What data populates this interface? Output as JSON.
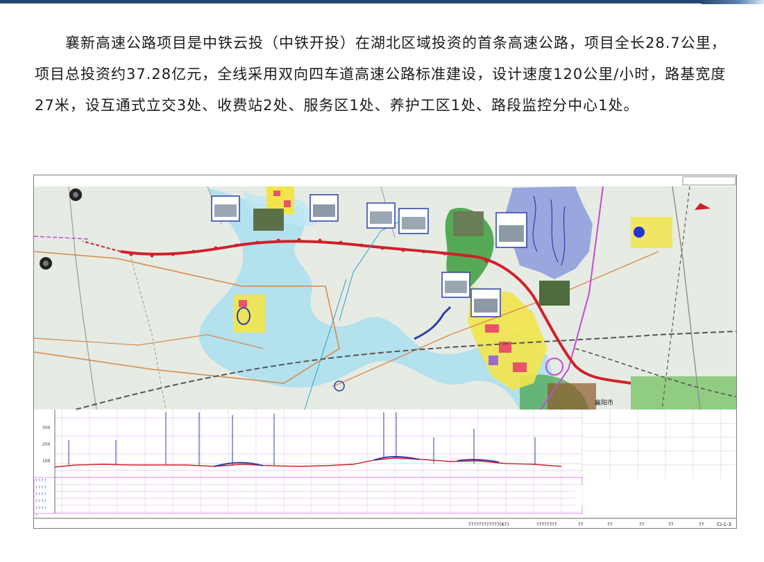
{
  "article": {
    "paragraph": "　　襄新高速公路项目是中铁云投（中铁开投）在湖北区域投资的首条高速公路，项目全长28.7公里，项目总投资约37.28亿元，全线采用双向四车道高速公路标准建设，设计速度120公里/小时，路基宽度27米，设互通式立交3处、收费站2处、服务区1处、养护工区1处、路段监控分中心1处。"
  },
  "figure": {
    "title_block": {
      "cell1": "????????????(K?)",
      "cell2": "????????",
      "cells": [
        "??",
        "??",
        "??",
        "??",
        "??",
        "??"
      ],
      "drawing_no": "CI-1-3"
    },
    "profile_axis_labels": [
      "300",
      "200",
      "100"
    ],
    "profile_row_labels": [
      "? ? ? ?",
      "? ? ? ?",
      "? ? ? ?",
      "? ? ? ?",
      "? ? ? ?",
      "?"
    ],
    "map_place_label": "襄阳市",
    "colors": {
      "route": "#d0202a",
      "river": "#9bd8ee",
      "lake": "#5a6fd8",
      "railway": "#555555",
      "urban_yellow": "#f2e54a",
      "urban_red": "#e8536a",
      "green": "#46a346",
      "road_orange": "#d88b4a",
      "profile_grid": "#c45be0"
    }
  },
  "watermark": {
    "text": ""
  }
}
